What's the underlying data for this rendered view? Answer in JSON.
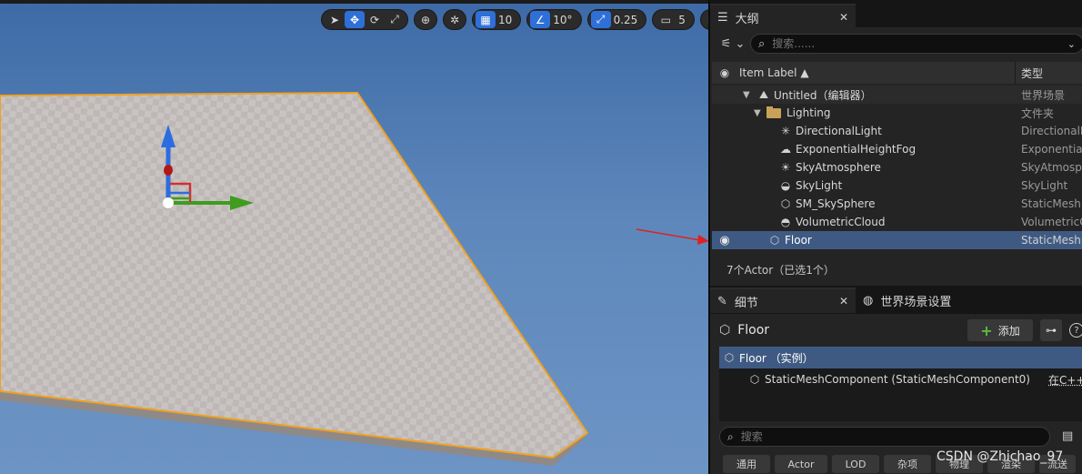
{
  "viewport": {
    "toolbar": {
      "grid_snap_value": "10",
      "rotation_snap_value": "10°",
      "scale_snap_value": "0.25",
      "camera_speed_value": "5"
    }
  },
  "outliner": {
    "tab_title": "大纲",
    "search_placeholder": "搜索......",
    "columns": {
      "label": "Item Label ▲",
      "type": "类型"
    },
    "items": [
      {
        "name": "Untitled（编辑器）",
        "type": "世界场景"
      },
      {
        "name": "Lighting",
        "type": "文件夹"
      },
      {
        "name": "DirectionalLight",
        "type": "DirectionalL"
      },
      {
        "name": "ExponentialHeightFog",
        "type": "Exponential"
      },
      {
        "name": "SkyAtmosphere",
        "type": "SkyAtmosp"
      },
      {
        "name": "SkyLight",
        "type": "SkyLight"
      },
      {
        "name": "SM_SkySphere",
        "type": "StaticMesh"
      },
      {
        "name": "VolumetricCloud",
        "type": "VolumetricC"
      },
      {
        "name": "Floor",
        "type": "StaticMesh"
      }
    ],
    "footer": "7个Actor（已选1个）"
  },
  "details": {
    "tab_title": "细节",
    "world_settings_tab": "世界场景设置",
    "actor_name": "Floor",
    "add_label": "添加",
    "help_label": "?",
    "components": [
      {
        "name": "Floor （实例）"
      },
      {
        "name": "StaticMeshComponent (StaticMeshComponent0)",
        "link": "在C++"
      }
    ],
    "search_placeholder": "搜索",
    "categories": [
      "通用",
      "Actor",
      "LOD",
      "杂项",
      "物理",
      "渲染",
      "流送"
    ]
  },
  "watermark": "CSDN @Zhichao_97",
  "colors": {
    "selection": "#3f5a82",
    "active_tool": "#2f6fd8",
    "add_plus": "#5cbc3c",
    "floor_outline": "#f0a020"
  }
}
